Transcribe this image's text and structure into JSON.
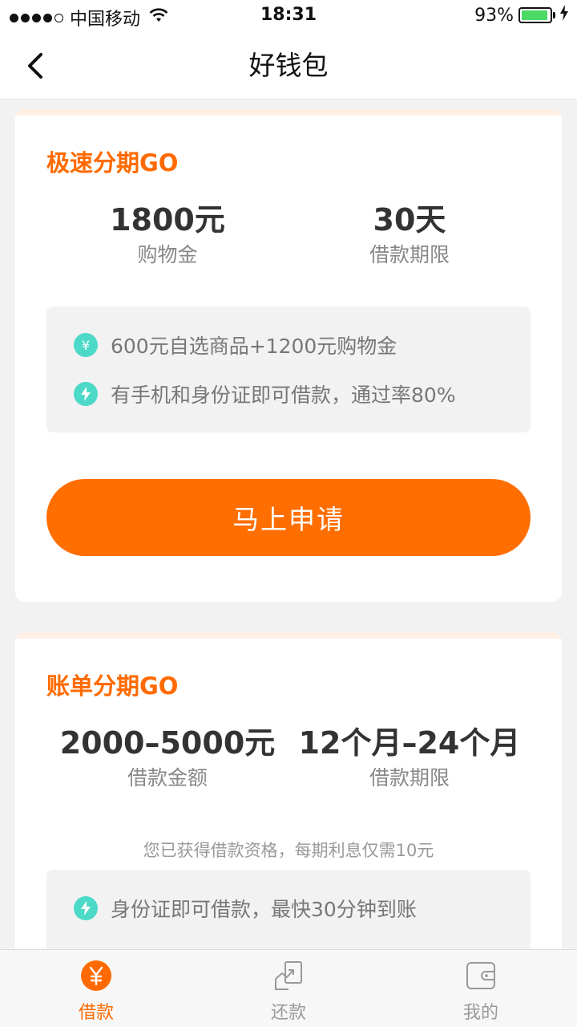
{
  "status_bar": {
    "carrier": "中国移动",
    "time": "18:31",
    "battery_percent": "93%",
    "battery_level": 0.93,
    "icons": [
      "signal-dots-icon",
      "wifi-icon",
      "battery-icon",
      "charging-bolt-icon"
    ]
  },
  "nav": {
    "title": "好钱包",
    "back_icon": "chevron-left-icon"
  },
  "card1": {
    "title": "极速分期GO",
    "stat1": {
      "value": "1800元",
      "label": "购物金"
    },
    "stat2": {
      "value": "30天",
      "label": "借款期限"
    },
    "features": [
      {
        "icon": "yuan-icon",
        "text": "600元自选商品+1200元购物金"
      },
      {
        "icon": "lightning-icon",
        "text": "有手机和身份证即可借款，通过率80%"
      }
    ],
    "button_label": "马上申请"
  },
  "card2": {
    "title": "账单分期GO",
    "stat1": {
      "value": "2000–5000元",
      "label": "借款金额"
    },
    "stat2": {
      "value": "12个月–24个月",
      "label": "借款期限"
    },
    "eligibility": "您已获得借款资格，每期利息仅需10元",
    "features": [
      {
        "icon": "lightning-icon",
        "text": "身份证即可借款，最快30分钟到账"
      }
    ]
  },
  "tabs": [
    {
      "label": "借款",
      "icon": "yuan-circle-icon",
      "active": true
    },
    {
      "label": "还款",
      "icon": "repay-icon",
      "active": false
    },
    {
      "label": "我的",
      "icon": "wallet-icon",
      "active": false
    }
  ],
  "colors": {
    "accent": "#ff6a00",
    "feature_icon": "#4dd9c8",
    "battery": "#4cd964"
  }
}
